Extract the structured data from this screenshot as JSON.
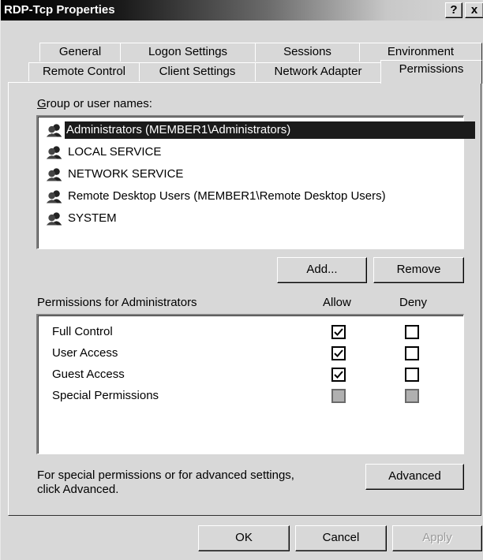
{
  "window": {
    "title": "RDP-Tcp Properties",
    "help_label": "?",
    "close_label": "x"
  },
  "tabs": {
    "row1": [
      "General",
      "Logon Settings",
      "Sessions",
      "Environment"
    ],
    "row2": [
      "Remote Control",
      "Client Settings",
      "Network Adapter",
      "Permissions"
    ],
    "active": "Permissions"
  },
  "users": {
    "label": "Group or user names:",
    "items": [
      {
        "label": "Administrators (MEMBER1\\Administrators)",
        "selected": true,
        "icon": "user-group-icon"
      },
      {
        "label": "LOCAL SERVICE",
        "selected": false,
        "icon": "user-group-icon"
      },
      {
        "label": "NETWORK SERVICE",
        "selected": false,
        "icon": "user-group-icon"
      },
      {
        "label": "Remote Desktop Users (MEMBER1\\Remote Desktop Users)",
        "selected": false,
        "icon": "user-group-icon"
      },
      {
        "label": "SYSTEM",
        "selected": false,
        "icon": "user-group-icon"
      }
    ],
    "add_label": "Add...",
    "remove_label": "Remove"
  },
  "permissions": {
    "label": "Permissions for Administrators",
    "allow_header": "Allow",
    "deny_header": "Deny",
    "rows": [
      {
        "name": "Full Control",
        "allow": "checked",
        "deny": "unchecked"
      },
      {
        "name": "User Access",
        "allow": "checked",
        "deny": "unchecked"
      },
      {
        "name": "Guest Access",
        "allow": "checked",
        "deny": "unchecked"
      },
      {
        "name": "Special Permissions",
        "allow": "disabled",
        "deny": "disabled"
      }
    ]
  },
  "advanced": {
    "line1": "For special permissions or for advanced settings,",
    "line2": "click Advanced.",
    "button_label": "Advanced"
  },
  "footer": {
    "ok_label": "OK",
    "cancel_label": "Cancel",
    "apply_label": "Apply"
  }
}
